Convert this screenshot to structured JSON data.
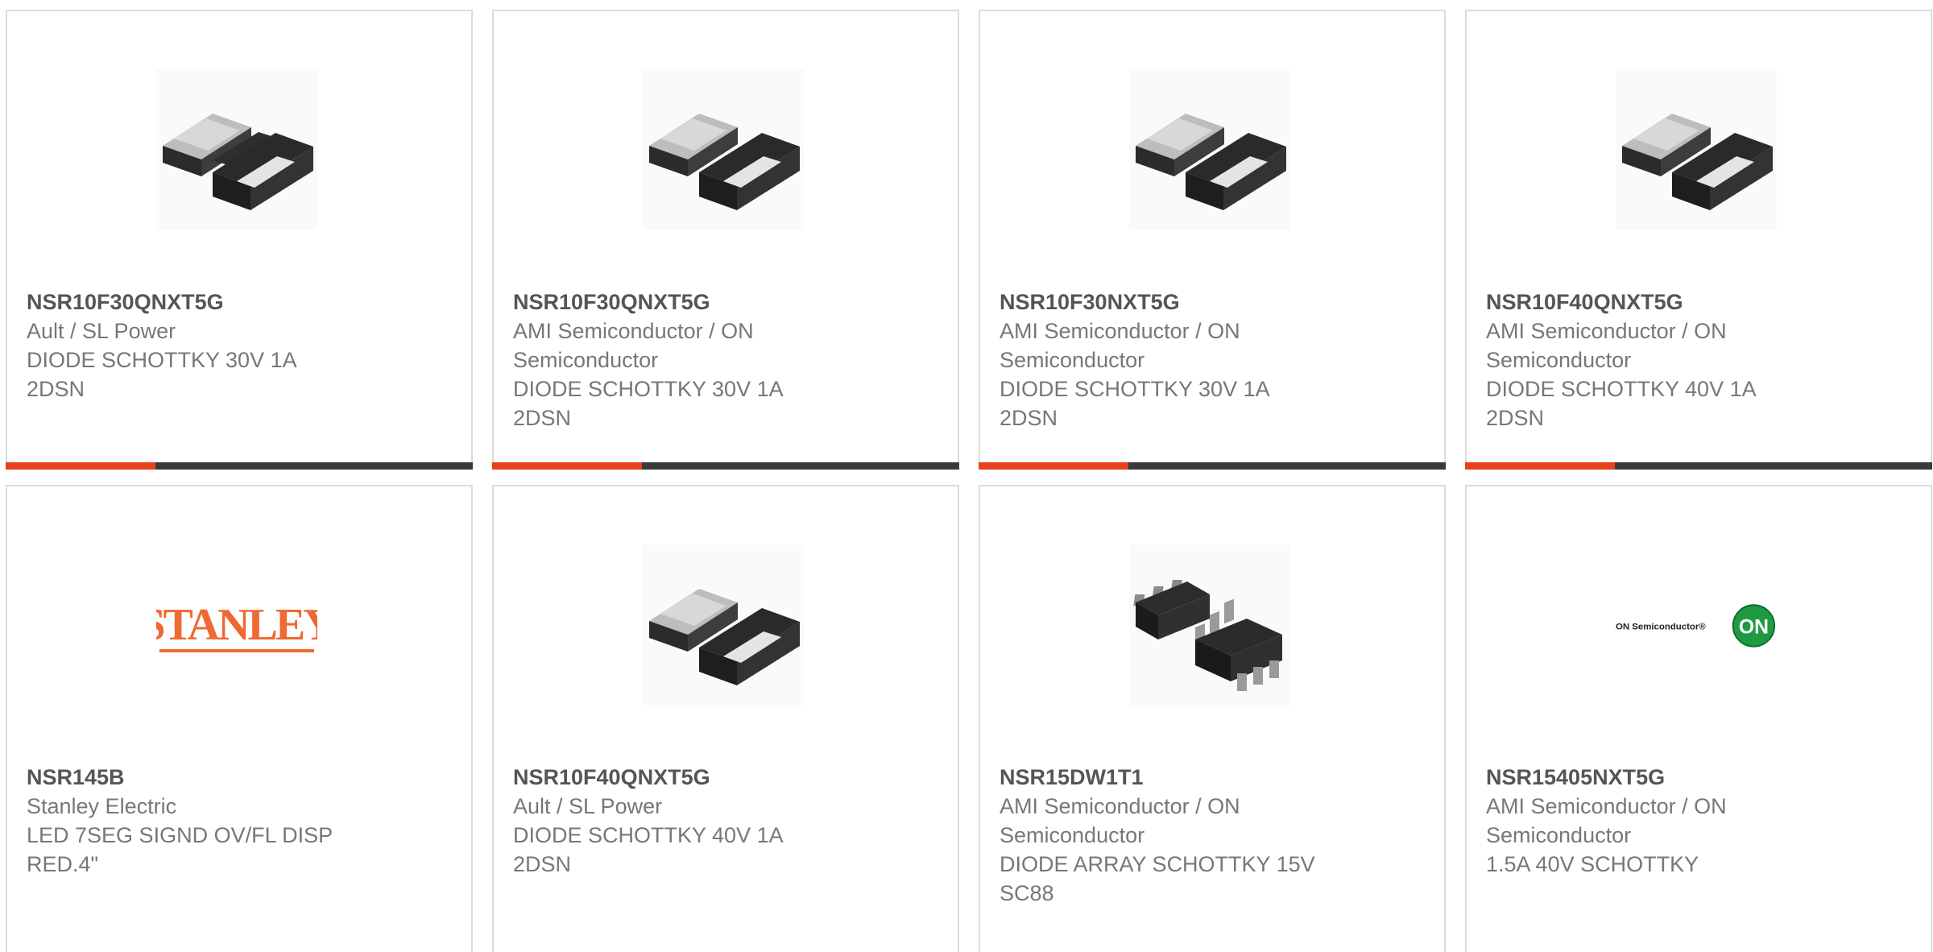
{
  "accent_color": "#e8401c",
  "bar_color": "#3a3a3a",
  "products": [
    {
      "part_number": "NSR10F30QNXT5G",
      "manufacturer": "Ault / SL Power",
      "description": "DIODE SCHOTTKY 30V 1A\n2DSN",
      "image": "dsn2-package-icon",
      "progress": 0.32
    },
    {
      "part_number": "NSR10F30QNXT5G",
      "manufacturer": "AMI Semiconductor / ON\nSemiconductor",
      "description": "DIODE SCHOTTKY 30V 1A\n2DSN",
      "image": "dsn2-package-icon",
      "progress": 0.32
    },
    {
      "part_number": "NSR10F30NXT5G",
      "manufacturer": "AMI Semiconductor / ON\nSemiconductor",
      "description": "DIODE SCHOTTKY 30V 1A\n2DSN",
      "image": "dsn2-package-icon",
      "progress": 0.32
    },
    {
      "part_number": "NSR10F40QNXT5G",
      "manufacturer": "AMI Semiconductor / ON\nSemiconductor",
      "description": "DIODE SCHOTTKY 40V 1A\n2DSN",
      "image": "dsn2-package-icon",
      "progress": 0.32
    },
    {
      "part_number": "NSR145B",
      "manufacturer": "Stanley Electric",
      "description": "LED 7SEG SIGND OV/FL DISP\nRED.4\"",
      "image": "stanley-logo",
      "logo_text": "STANLEY"
    },
    {
      "part_number": "NSR10F40QNXT5G",
      "manufacturer": "Ault / SL Power",
      "description": "DIODE SCHOTTKY 40V 1A\n2DSN",
      "image": "dsn2-package-icon"
    },
    {
      "part_number": "NSR15DW1T1",
      "manufacturer": "AMI Semiconductor / ON\nSemiconductor",
      "description": "DIODE ARRAY SCHOTTKY 15V\nSC88",
      "image": "sc88-package-icon"
    },
    {
      "part_number": "NSR15405NXT5G",
      "manufacturer": "AMI Semiconductor / ON\nSemiconductor",
      "description": "1.5A 40V SCHOTTKY",
      "image": "on-semiconductor-logo",
      "logo_text": "ON Semiconductor®",
      "logo_badge": "ON"
    }
  ]
}
